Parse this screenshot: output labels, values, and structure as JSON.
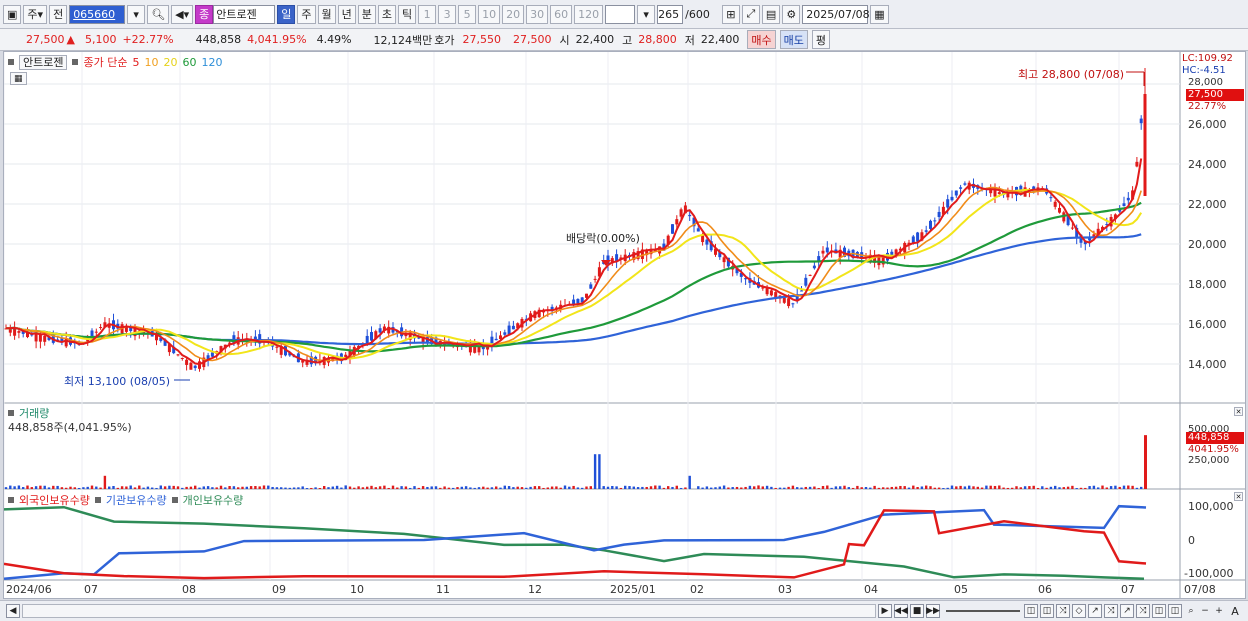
{
  "toolbar": {
    "period": "주",
    "view": "전",
    "code": "065660",
    "name_badge": "종",
    "name": "안트로젠",
    "tabs": [
      "일",
      "주",
      "월",
      "년",
      "분",
      "초",
      "틱"
    ],
    "tab_selected": "일",
    "nums": [
      "1",
      "3",
      "5",
      "10",
      "20",
      "30",
      "60",
      "120"
    ],
    "count": "265",
    "count_total": "/600",
    "date": "2025/07/08"
  },
  "quote": {
    "price": "27,500",
    "change": "5,100",
    "change_pct": "+22.77%",
    "volume": "448,858",
    "vol_pct": "4,041.95%",
    "turnover": "4.49%",
    "amount": "12,124백만",
    "bid_label": "호가",
    "bid1": "27,550",
    "bid2": "27,500",
    "open_label": "시",
    "open": "22,400",
    "high_label": "고",
    "high": "28,800",
    "low_label": "저",
    "low": "22,400",
    "buy": "매수",
    "sell": "매도",
    "avg": "평"
  },
  "price_panel": {
    "stock_name": "안트로젠",
    "ma_label": "종가 단순",
    "ma_periods": [
      "5",
      "10",
      "20",
      "60",
      "120"
    ],
    "ma_colors": [
      "#e11b1b",
      "#f08c1a",
      "#f2e51a",
      "#1f9a3a",
      "#2f63d8"
    ],
    "high_annotation": "최고 28,800 (07/08)",
    "low_annotation": "최저 13,100 (08/05)",
    "dividend_annotation": "배당락(0.00%)",
    "lc": "LC:109.92",
    "hc": "HC:-4.51",
    "price_tag": "27,500",
    "pct_tag": "22.77%",
    "y_ticks": [
      "28,000",
      "26,000",
      "24,000",
      "22,000",
      "20,000",
      "18,000",
      "16,000",
      "14,000"
    ]
  },
  "volume_panel": {
    "title": "거래량",
    "info": "448,858주(4,041.95%)",
    "tag": "448,858",
    "pct_tag": "4041.95%",
    "y_ticks": [
      "500,000",
      "250,000"
    ]
  },
  "holdings_panel": {
    "series": [
      "외국인보유수량",
      "기관보유수량",
      "개인보유수량"
    ],
    "colors": [
      "#e11b1b",
      "#2f63d8",
      "#2e8b57"
    ],
    "y_ticks": [
      "100,000",
      "0",
      "-100,000"
    ]
  },
  "x_ticks": [
    "2024/06",
    "07",
    "08",
    "09",
    "10",
    "11",
    "12",
    "2025/01",
    "02",
    "03",
    "04",
    "05",
    "06",
    "07",
    "07/08"
  ]
}
